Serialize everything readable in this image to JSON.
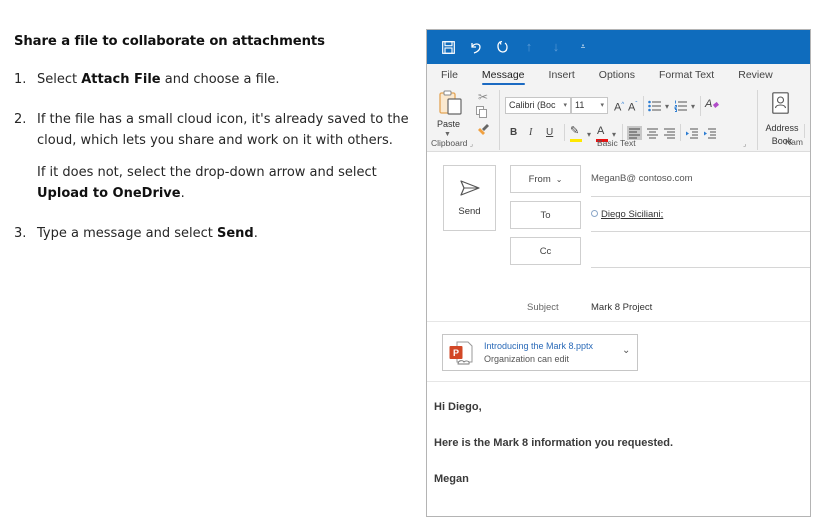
{
  "instructions": {
    "title": "Share a file to collaborate on attachments",
    "steps": [
      {
        "num": "1.",
        "parts": [
          {
            "pre": "Select ",
            "bold": "Attach File",
            "post": " and choose a file."
          }
        ]
      },
      {
        "num": "2.",
        "parts": [
          {
            "pre": "If the file has a small cloud icon, it's already saved to the cloud, which lets you share and work on it with others.",
            "bold": "",
            "post": ""
          },
          {
            "pre": "If it does not, select the drop-down arrow and select ",
            "bold": "Upload to OneDrive",
            "post": "."
          }
        ]
      },
      {
        "num": "3.",
        "parts": [
          {
            "pre": "Type a message and select ",
            "bold": "Send",
            "post": "."
          }
        ]
      }
    ]
  },
  "outlook": {
    "colors": {
      "titlebar": "#0f6cbd",
      "ribbon": "#f3f3f3",
      "accent": "#1b6ac2",
      "link": "#2a6ab8"
    },
    "quick_access": [
      "save-icon",
      "undo-icon",
      "redo-icon",
      "up-arrow-icon",
      "down-arrow-icon",
      "customize-dropdown-icon"
    ],
    "tabs": [
      {
        "label": "File",
        "active": false
      },
      {
        "label": "Message",
        "active": true
      },
      {
        "label": "Insert",
        "active": false
      },
      {
        "label": "Options",
        "active": false
      },
      {
        "label": "Format Text",
        "active": false
      },
      {
        "label": "Review",
        "active": false
      }
    ],
    "ribbon": {
      "clipboard": {
        "label": "Clipboard",
        "paste": "Paste"
      },
      "basic_text": {
        "label": "Basic Text",
        "font": "Calibri (Boc",
        "size": "11",
        "bold": "B",
        "italic": "I",
        "underline": "U",
        "font_color": "A",
        "grow": "A",
        "shrink": "A"
      },
      "names": {
        "label": "Nam",
        "address_book_line1": "Address",
        "address_book_line2": "Book"
      }
    },
    "compose": {
      "send": "Send",
      "from_label": "From",
      "from_value": "MeganB@ contoso.com",
      "to_label": "To",
      "to_value": "Diego Siciliani;",
      "cc_label": "Cc",
      "cc_value": "",
      "subject_label": "Subject",
      "subject_value": "Mark 8 Project",
      "attachment": {
        "name": "Introducing the Mark 8.pptx",
        "status": "Organization can edit",
        "icon": "P"
      },
      "body": [
        "Hi Diego,",
        "Here is the Mark 8 information you requested.",
        "Megan"
      ]
    }
  }
}
